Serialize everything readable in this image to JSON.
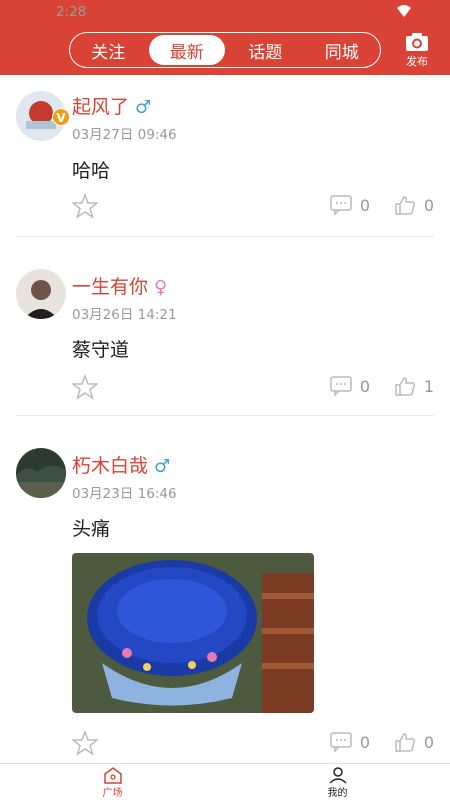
{
  "status": {
    "time": "2:28"
  },
  "tabs": [
    {
      "label": "关注"
    },
    {
      "label": "最新"
    },
    {
      "label": "话题"
    },
    {
      "label": "同城"
    }
  ],
  "active_tab": "最新",
  "publish_label": "发布",
  "posts": [
    {
      "name": "起风了",
      "gender": "male",
      "time": "03月27日 09:46",
      "content": "哈哈",
      "comments": "0",
      "likes": "0",
      "verified": true
    },
    {
      "name": "一生有你",
      "gender": "female",
      "time": "03月26日 14:21",
      "content": "蔡守道",
      "comments": "0",
      "likes": "1",
      "verified": false
    },
    {
      "name": "朽木白哉",
      "gender": "male",
      "time": "03月23日 16:46",
      "content": "头痛",
      "comments": "0",
      "likes": "0",
      "verified": false,
      "has_image": true
    }
  ],
  "nav": [
    {
      "label": "广场"
    },
    {
      "label": "我的"
    }
  ],
  "colors": {
    "accent": "#d94336",
    "male": "#3ba3d6",
    "female": "#f07aa3"
  }
}
